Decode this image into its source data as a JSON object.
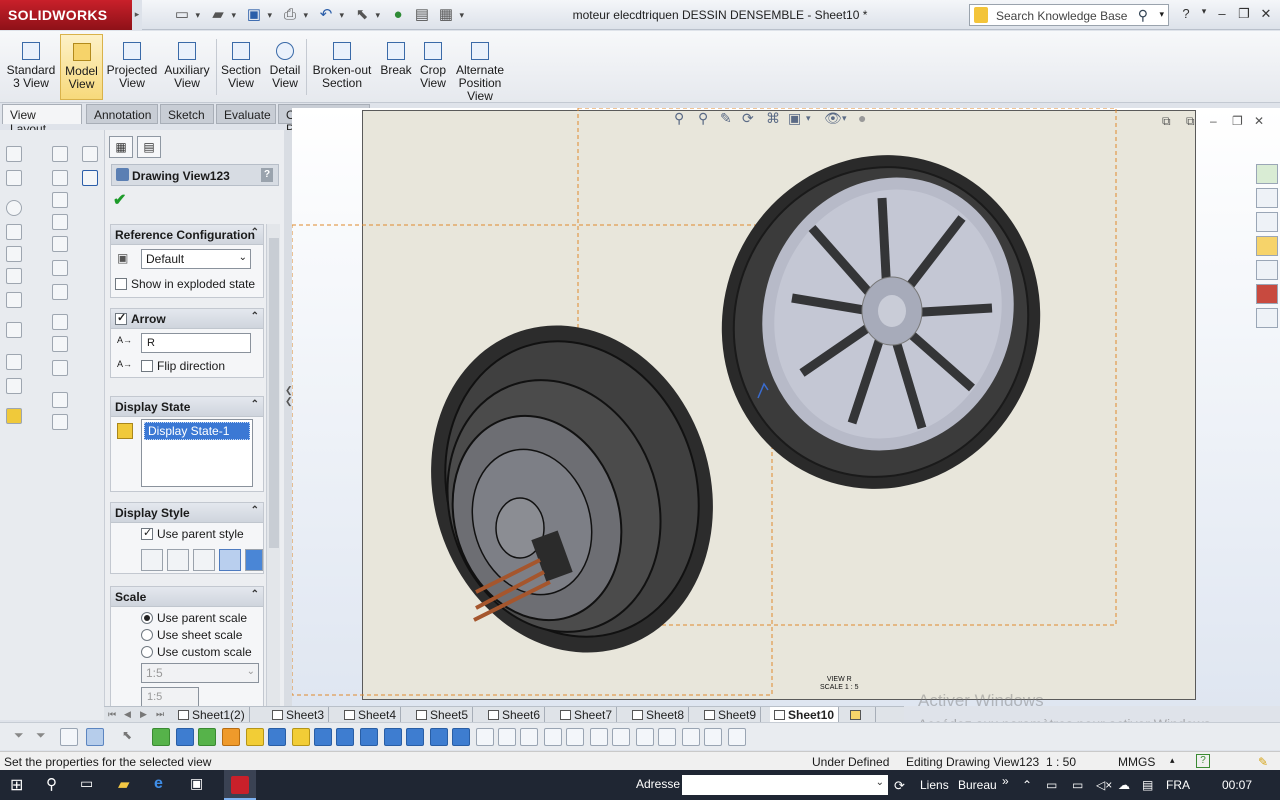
{
  "app": {
    "logo": "SOLIDWORKS",
    "title": "moteur elecdtriquen DESSIN DENSEMBLE - Sheet10 *",
    "search_placeholder": "Search Knowledge Base"
  },
  "commands": [
    {
      "label": "Standard 3 View"
    },
    {
      "label": "Model View"
    },
    {
      "label": "Projected View"
    },
    {
      "label": "Auxiliary View"
    },
    {
      "label": "Section View"
    },
    {
      "label": "Detail View"
    },
    {
      "label": "Broken-out Section"
    },
    {
      "label": "Break"
    },
    {
      "label": "Crop View"
    },
    {
      "label": "Alternate Position View"
    }
  ],
  "tabs": [
    "View Layout",
    "Annotation",
    "Sketch",
    "Evaluate",
    "Office Products"
  ],
  "property_manager": {
    "title": "Drawing View123",
    "help": "?",
    "reference_config": {
      "header": "Reference Configuration",
      "value": "Default",
      "exploded_label": "Show in exploded state"
    },
    "arrow": {
      "header": "Arrow",
      "label_value": "R",
      "flip_label": "Flip direction"
    },
    "display_state": {
      "header": "Display State",
      "item": "Display State-1"
    },
    "display_style": {
      "header": "Display Style",
      "parent_label": "Use parent style"
    },
    "scale": {
      "header": "Scale",
      "opt_parent": "Use parent scale",
      "opt_sheet": "Use sheet scale",
      "opt_custom": "Use custom scale",
      "custom_value": "1:5",
      "custom_input": "1:5"
    }
  },
  "view_label": {
    "line1": "VIEW R",
    "line2": "SCALE 1 : 5"
  },
  "sheet_tabs": [
    "Sheet1(2)",
    "Sheet3",
    "Sheet4",
    "Sheet5",
    "Sheet6",
    "Sheet7",
    "Sheet8",
    "Sheet9",
    "Sheet10"
  ],
  "status": {
    "message": "Set the properties for the selected view",
    "state": "Under Defined",
    "editing": "Editing Drawing View123",
    "scale": "1 : 50",
    "units": "MMGS"
  },
  "watermark": {
    "line1": "Activer Windows",
    "line2": "Accédez aux paramètres pour activer Windows."
  },
  "taskbar": {
    "address_label": "Adresse",
    "links": "Liens",
    "desktop": "Bureau",
    "lang": "FRA",
    "time": "00:07"
  },
  "colors": {
    "accent_red": "#c9202a",
    "selection_blue": "#3b78d4",
    "sheet_bg": "#e8e6db",
    "taskbar_bg": "#1f2633"
  }
}
